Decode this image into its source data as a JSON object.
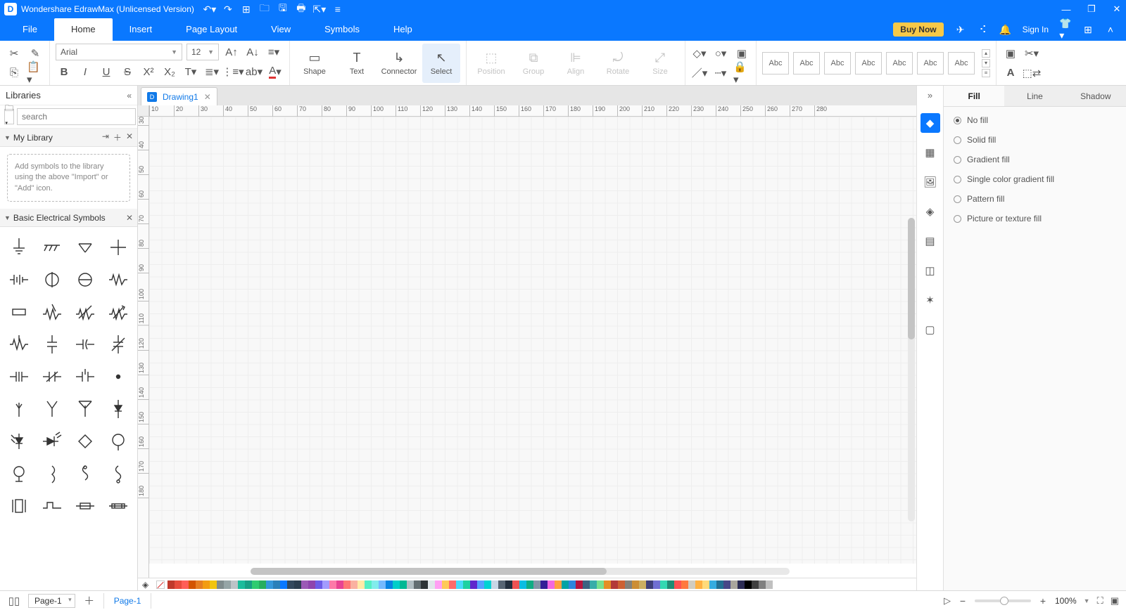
{
  "app": {
    "title": "Wondershare EdrawMax (Unlicensed Version)"
  },
  "menubar": {
    "tabs": [
      "File",
      "Home",
      "Insert",
      "Page Layout",
      "View",
      "Symbols",
      "Help"
    ],
    "active": 1,
    "buy_label": "Buy Now",
    "signin_label": "Sign In"
  },
  "ribbon": {
    "font_family": "Arial",
    "font_size": "12",
    "tools": {
      "shape": "Shape",
      "text": "Text",
      "connector": "Connector",
      "select": "Select",
      "position": "Position",
      "group": "Group",
      "align": "Align",
      "rotate": "Rotate",
      "size": "Size"
    },
    "style_presets": [
      "Abc",
      "Abc",
      "Abc",
      "Abc",
      "Abc",
      "Abc",
      "Abc"
    ]
  },
  "library": {
    "header": "Libraries",
    "search_placeholder": "search",
    "my_library": {
      "title": "My Library",
      "hint": "Add symbols to the library using the above \"Import\" or \"Add\" icon."
    },
    "section_title": "Basic Electrical Symbols"
  },
  "document": {
    "tab_name": "Drawing1"
  },
  "ruler": {
    "h": [
      "10",
      "20",
      "30",
      "40",
      "50",
      "60",
      "70",
      "80",
      "90",
      "100",
      "110",
      "120",
      "130",
      "140",
      "150",
      "160",
      "170",
      "180",
      "190",
      "200",
      "210",
      "220",
      "230",
      "240",
      "250",
      "260",
      "270",
      "280"
    ],
    "v": [
      "30",
      "40",
      "50",
      "60",
      "70",
      "80",
      "90",
      "100",
      "110",
      "120",
      "130",
      "140",
      "150",
      "160",
      "170",
      "180"
    ]
  },
  "right_panel": {
    "tabs": [
      "Fill",
      "Line",
      "Shadow"
    ],
    "active": 0,
    "options": [
      "No fill",
      "Solid fill",
      "Gradient fill",
      "Single color gradient fill",
      "Pattern fill",
      "Picture or texture fill"
    ],
    "selected": 0
  },
  "color_swatches": [
    "#c0392b",
    "#e74c3c",
    "#ff5e57",
    "#d35400",
    "#e67e22",
    "#f39c12",
    "#f1c40f",
    "#7f8c8d",
    "#95a5a6",
    "#bdc3c7",
    "#1abc9c",
    "#16a085",
    "#2ecc71",
    "#27ae60",
    "#3498db",
    "#2980b9",
    "#0a78ff",
    "#34495e",
    "#2c3e50",
    "#9b59b6",
    "#8e44ad",
    "#6c5ce7",
    "#a29bfe",
    "#fd79a8",
    "#e84393",
    "#ff7675",
    "#fab1a0",
    "#ffeaa7",
    "#55efc4",
    "#81ecec",
    "#74b9ff",
    "#0984e3",
    "#00cec9",
    "#00b894",
    "#b2bec3",
    "#636e72",
    "#2d3436",
    "#dfe6e9",
    "#ff9ff3",
    "#feca57",
    "#ff6b6b",
    "#48dbfb",
    "#1dd1a1",
    "#5f27cd",
    "#54a0ff",
    "#00d2d3",
    "#c8d6e5",
    "#576574",
    "#222f3e",
    "#ee5253",
    "#0abde3",
    "#10ac84",
    "#8395a7",
    "#341f97",
    "#f368e0",
    "#ff9f43",
    "#01a3a4",
    "#2e86de",
    "#b71540",
    "#3c6382",
    "#38ada9",
    "#78e08f",
    "#e58e26",
    "#b33939",
    "#cd6133",
    "#84817a",
    "#cc8e35",
    "#ccae62",
    "#40407a",
    "#706fd3",
    "#33d9b2",
    "#218c74",
    "#ff5252",
    "#ff793f",
    "#d1ccc0",
    "#ffb142",
    "#ffda79",
    "#34ace0",
    "#227093",
    "#474787",
    "#aaa69d",
    "#2c2c54",
    "#000000",
    "#404040",
    "#808080",
    "#c0c0c0",
    "#ffffff"
  ],
  "statusbar": {
    "page_selector": "Page-1",
    "page_tab": "Page-1",
    "zoom": "100%"
  }
}
